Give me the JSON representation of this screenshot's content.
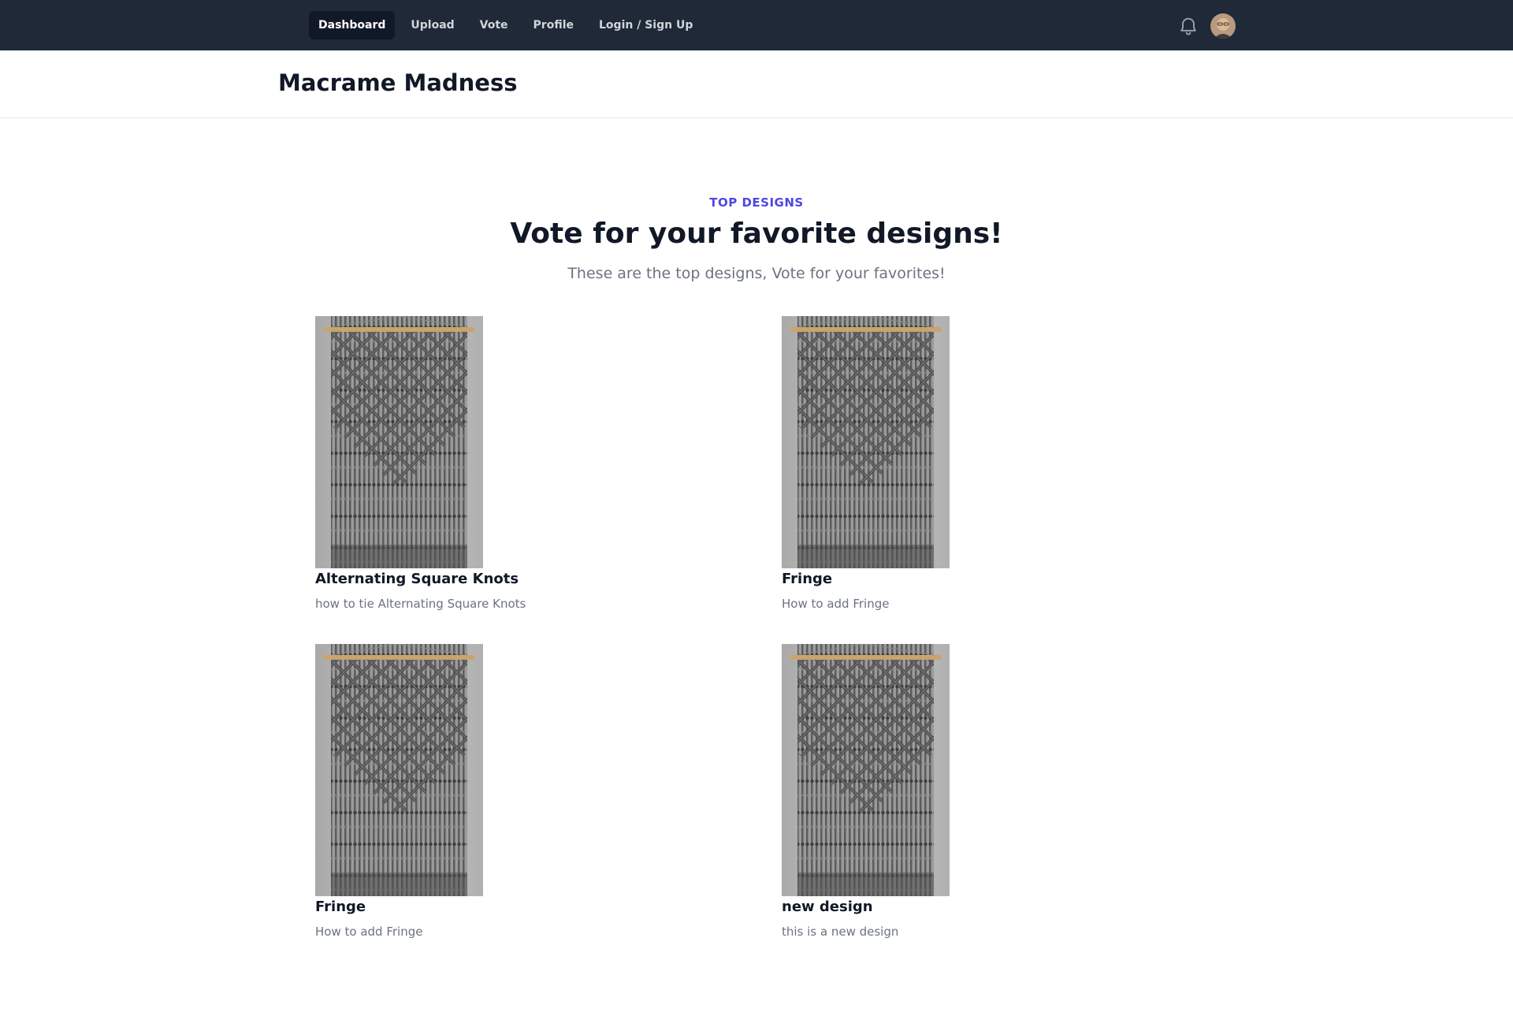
{
  "nav": {
    "links": [
      {
        "label": "Dashboard",
        "active": true
      },
      {
        "label": "Upload",
        "active": false
      },
      {
        "label": "Vote",
        "active": false
      },
      {
        "label": "Profile",
        "active": false
      },
      {
        "label": "Login / Sign Up",
        "active": false
      }
    ],
    "icons": {
      "notifications": "bell-icon",
      "user": "avatar"
    }
  },
  "header": {
    "title": "Macrame Madness"
  },
  "hero": {
    "eyebrow": "TOP DESIGNS",
    "headline": "Vote for your favorite designs!",
    "subhead": "These are the top designs, Vote for your favorites!"
  },
  "designs": [
    {
      "title": "Alternating Square Knots",
      "description": "how to tie Alternating Square Knots"
    },
    {
      "title": "Fringe",
      "description": "How to add Fringe"
    },
    {
      "title": "Fringe",
      "description": "How to add Fringe"
    },
    {
      "title": "new design",
      "description": "this is a new design"
    }
  ],
  "colors": {
    "nav_bg": "#1f2937",
    "accent": "#4f46e5",
    "text": "#111827",
    "muted": "#6b7280"
  }
}
